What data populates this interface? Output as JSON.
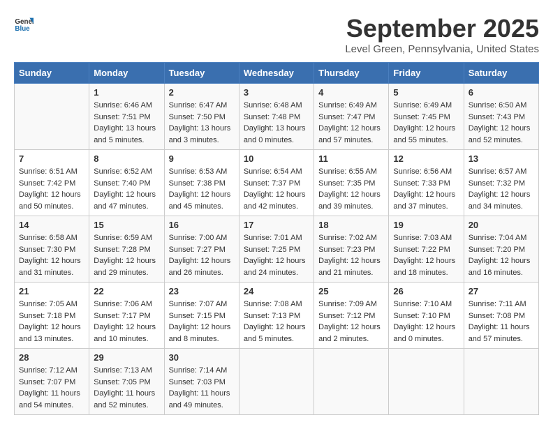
{
  "header": {
    "logo": {
      "text_general": "General",
      "text_blue": "Blue",
      "icon_label": "general-blue-logo"
    },
    "title": "September 2025",
    "location": "Level Green, Pennsylvania, United States"
  },
  "calendar": {
    "days_of_week": [
      "Sunday",
      "Monday",
      "Tuesday",
      "Wednesday",
      "Thursday",
      "Friday",
      "Saturday"
    ],
    "weeks": [
      [
        {
          "day": "",
          "info": ""
        },
        {
          "day": "1",
          "info": "Sunrise: 6:46 AM\nSunset: 7:51 PM\nDaylight: 13 hours\nand 5 minutes."
        },
        {
          "day": "2",
          "info": "Sunrise: 6:47 AM\nSunset: 7:50 PM\nDaylight: 13 hours\nand 3 minutes."
        },
        {
          "day": "3",
          "info": "Sunrise: 6:48 AM\nSunset: 7:48 PM\nDaylight: 13 hours\nand 0 minutes."
        },
        {
          "day": "4",
          "info": "Sunrise: 6:49 AM\nSunset: 7:47 PM\nDaylight: 12 hours\nand 57 minutes."
        },
        {
          "day": "5",
          "info": "Sunrise: 6:49 AM\nSunset: 7:45 PM\nDaylight: 12 hours\nand 55 minutes."
        },
        {
          "day": "6",
          "info": "Sunrise: 6:50 AM\nSunset: 7:43 PM\nDaylight: 12 hours\nand 52 minutes."
        }
      ],
      [
        {
          "day": "7",
          "info": "Sunrise: 6:51 AM\nSunset: 7:42 PM\nDaylight: 12 hours\nand 50 minutes."
        },
        {
          "day": "8",
          "info": "Sunrise: 6:52 AM\nSunset: 7:40 PM\nDaylight: 12 hours\nand 47 minutes."
        },
        {
          "day": "9",
          "info": "Sunrise: 6:53 AM\nSunset: 7:38 PM\nDaylight: 12 hours\nand 45 minutes."
        },
        {
          "day": "10",
          "info": "Sunrise: 6:54 AM\nSunset: 7:37 PM\nDaylight: 12 hours\nand 42 minutes."
        },
        {
          "day": "11",
          "info": "Sunrise: 6:55 AM\nSunset: 7:35 PM\nDaylight: 12 hours\nand 39 minutes."
        },
        {
          "day": "12",
          "info": "Sunrise: 6:56 AM\nSunset: 7:33 PM\nDaylight: 12 hours\nand 37 minutes."
        },
        {
          "day": "13",
          "info": "Sunrise: 6:57 AM\nSunset: 7:32 PM\nDaylight: 12 hours\nand 34 minutes."
        }
      ],
      [
        {
          "day": "14",
          "info": "Sunrise: 6:58 AM\nSunset: 7:30 PM\nDaylight: 12 hours\nand 31 minutes."
        },
        {
          "day": "15",
          "info": "Sunrise: 6:59 AM\nSunset: 7:28 PM\nDaylight: 12 hours\nand 29 minutes."
        },
        {
          "day": "16",
          "info": "Sunrise: 7:00 AM\nSunset: 7:27 PM\nDaylight: 12 hours\nand 26 minutes."
        },
        {
          "day": "17",
          "info": "Sunrise: 7:01 AM\nSunset: 7:25 PM\nDaylight: 12 hours\nand 24 minutes."
        },
        {
          "day": "18",
          "info": "Sunrise: 7:02 AM\nSunset: 7:23 PM\nDaylight: 12 hours\nand 21 minutes."
        },
        {
          "day": "19",
          "info": "Sunrise: 7:03 AM\nSunset: 7:22 PM\nDaylight: 12 hours\nand 18 minutes."
        },
        {
          "day": "20",
          "info": "Sunrise: 7:04 AM\nSunset: 7:20 PM\nDaylight: 12 hours\nand 16 minutes."
        }
      ],
      [
        {
          "day": "21",
          "info": "Sunrise: 7:05 AM\nSunset: 7:18 PM\nDaylight: 12 hours\nand 13 minutes."
        },
        {
          "day": "22",
          "info": "Sunrise: 7:06 AM\nSunset: 7:17 PM\nDaylight: 12 hours\nand 10 minutes."
        },
        {
          "day": "23",
          "info": "Sunrise: 7:07 AM\nSunset: 7:15 PM\nDaylight: 12 hours\nand 8 minutes."
        },
        {
          "day": "24",
          "info": "Sunrise: 7:08 AM\nSunset: 7:13 PM\nDaylight: 12 hours\nand 5 minutes."
        },
        {
          "day": "25",
          "info": "Sunrise: 7:09 AM\nSunset: 7:12 PM\nDaylight: 12 hours\nand 2 minutes."
        },
        {
          "day": "26",
          "info": "Sunrise: 7:10 AM\nSunset: 7:10 PM\nDaylight: 12 hours\nand 0 minutes."
        },
        {
          "day": "27",
          "info": "Sunrise: 7:11 AM\nSunset: 7:08 PM\nDaylight: 11 hours\nand 57 minutes."
        }
      ],
      [
        {
          "day": "28",
          "info": "Sunrise: 7:12 AM\nSunset: 7:07 PM\nDaylight: 11 hours\nand 54 minutes."
        },
        {
          "day": "29",
          "info": "Sunrise: 7:13 AM\nSunset: 7:05 PM\nDaylight: 11 hours\nand 52 minutes."
        },
        {
          "day": "30",
          "info": "Sunrise: 7:14 AM\nSunset: 7:03 PM\nDaylight: 11 hours\nand 49 minutes."
        },
        {
          "day": "",
          "info": ""
        },
        {
          "day": "",
          "info": ""
        },
        {
          "day": "",
          "info": ""
        },
        {
          "day": "",
          "info": ""
        }
      ]
    ]
  }
}
